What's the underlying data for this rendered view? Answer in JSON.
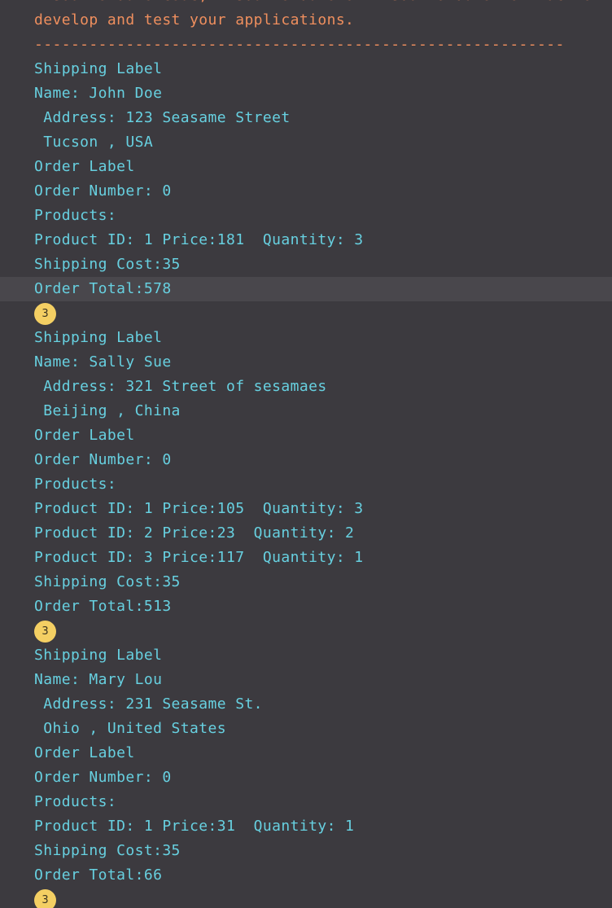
{
  "header": {
    "line1": "Visual Studio Code, Visual Studio or Visual Studio for Mac to",
    "line2": "develop and test your applications.",
    "separator": "----------------------------------------------------------"
  },
  "output_lines": [
    "Shipping Label",
    "Name: John Doe",
    " Address: 123 Seasame Street",
    " Tucson , USA",
    "Order Label",
    "Order Number: 0",
    "Products:",
    "Product ID: 1 Price:181  Quantity: 3",
    "Shipping Cost:35",
    "Order Total:578",
    "3",
    "Shipping Label",
    "Name: Sally Sue",
    " Address: 321 Street of sesamaes",
    " Beijing , China",
    "Order Label",
    "Order Number: 0",
    "Products:",
    "Product ID: 1 Price:105  Quantity: 3",
    "Product ID: 2 Price:23  Quantity: 2",
    "Product ID: 3 Price:117  Quantity: 1",
    "Shipping Cost:35",
    "Order Total:513",
    "3",
    "Shipping Label",
    "Name: Mary Lou",
    " Address: 231 Seasame St.",
    " Ohio , United States",
    "Order Label",
    "Order Number: 0",
    "Products:",
    "Product ID: 1 Price:31  Quantity: 1",
    "Shipping Cost:35",
    "Order Total:66",
    "3"
  ],
  "colors": {
    "background": "#3c3a3f",
    "highlight_row": "#49474c",
    "output_text": "#67d0e0",
    "header_text": "#ef8f5e",
    "badge_bg": "#f4cf63"
  }
}
